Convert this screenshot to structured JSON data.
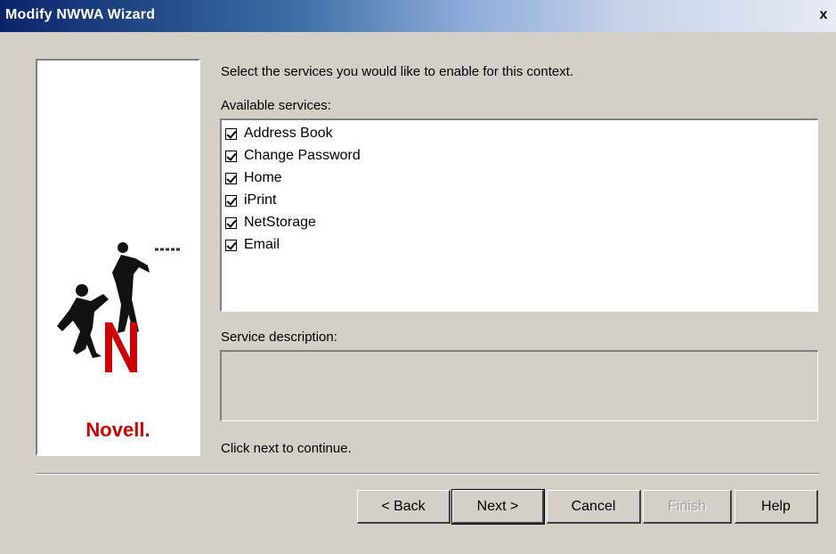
{
  "window": {
    "title": "Modify NWWA Wizard",
    "close_glyph": "x"
  },
  "side_panel": {
    "logo_text": "Novell.",
    "brand_color": "#cc0000"
  },
  "content": {
    "instruction": "Select the services you would like to enable for this context.",
    "available_label": "Available services:",
    "services": [
      {
        "label": "Address Book",
        "checked": true
      },
      {
        "label": "Change Password",
        "checked": true
      },
      {
        "label": "Home",
        "checked": true
      },
      {
        "label": "iPrint",
        "checked": true
      },
      {
        "label": "NetStorage",
        "checked": true
      },
      {
        "label": "Email",
        "checked": true
      }
    ],
    "description_label": "Service description:",
    "description_value": "",
    "footer_text": "Click next to continue."
  },
  "buttons": {
    "back": "< Back",
    "next": "Next >",
    "cancel": "Cancel",
    "finish": "Finish",
    "help": "Help"
  }
}
